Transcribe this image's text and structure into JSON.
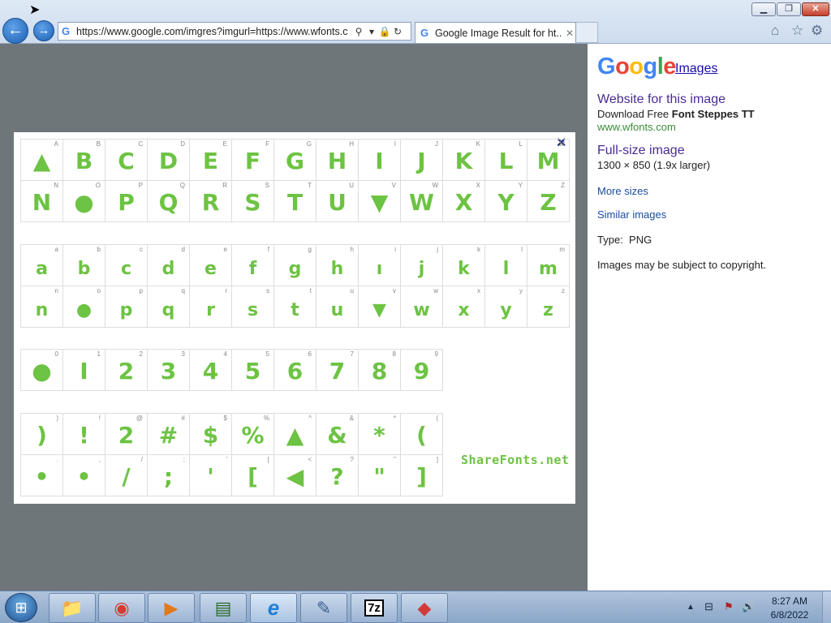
{
  "window": {
    "min_glyph": "▁",
    "max_glyph": "❐",
    "close_glyph": "✕"
  },
  "nav": {
    "back_glyph": "←",
    "forward_glyph": "→"
  },
  "address": {
    "favicon": "G",
    "url": "https://www.google.com/imgres?imgurl=https://www.wfonts.c",
    "search_glyph": "⚲",
    "dropdown_glyph": "▾",
    "lock_glyph": "🔒",
    "refresh_glyph": "↻"
  },
  "tab": {
    "favicon": "G",
    "title": "Google Image Result for ht...",
    "close_glyph": "✕"
  },
  "toolbar": {
    "home_glyph": "⌂",
    "star_glyph": "☆",
    "gear_glyph": "⚙"
  },
  "viewer": {
    "close_glyph": "✕",
    "upper": {
      "labels": [
        "A",
        "B",
        "C",
        "D",
        "E",
        "F",
        "G",
        "H",
        "I",
        "J",
        "K",
        "L",
        "M",
        "N",
        "O",
        "P",
        "Q",
        "R",
        "S",
        "T",
        "U",
        "V",
        "W",
        "X",
        "Y",
        "Z"
      ],
      "glyphs": [
        "▲",
        "B",
        "C",
        "D",
        "E",
        "F",
        "G",
        "H",
        "I",
        "J",
        "K",
        "L",
        "M",
        "N",
        "●",
        "P",
        "Q",
        "R",
        "S",
        "T",
        "U",
        "▼",
        "W",
        "X",
        "Y",
        "Z"
      ]
    },
    "lower": {
      "labels": [
        "a",
        "b",
        "c",
        "d",
        "e",
        "f",
        "g",
        "h",
        "i",
        "j",
        "k",
        "l",
        "m",
        "n",
        "o",
        "p",
        "q",
        "r",
        "s",
        "t",
        "u",
        "v",
        "w",
        "x",
        "y",
        "z"
      ],
      "glyphs": [
        "a",
        "b",
        "c",
        "d",
        "e",
        "f",
        "g",
        "h",
        "ı",
        "j",
        "k",
        "l",
        "m",
        "n",
        "●",
        "p",
        "q",
        "r",
        "s",
        "t",
        "u",
        "▼",
        "w",
        "x",
        "y",
        "z"
      ]
    },
    "digits": {
      "labels": [
        "0",
        "1",
        "2",
        "3",
        "4",
        "5",
        "6",
        "7",
        "8",
        "9"
      ],
      "glyphs": [
        "●",
        "I",
        "2",
        "3",
        "4",
        "5",
        "6",
        "7",
        "8",
        "9"
      ]
    },
    "symbols": {
      "labels": [
        ")",
        "!",
        "@",
        "#",
        "$",
        "%",
        "^",
        "&",
        "*",
        "(",
        ".",
        ",",
        "/",
        ";",
        "'",
        "[",
        "<",
        "?",
        "\"",
        "]"
      ],
      "glyphs": [
        ")",
        "!",
        "2",
        "#",
        "$",
        "%",
        "▲",
        "&",
        "*",
        "(",
        "•",
        "•",
        "/",
        ";",
        "'",
        "[",
        "◀",
        "?",
        "\"",
        "]"
      ]
    },
    "watermark": "ShareFonts.net"
  },
  "side": {
    "logo": [
      "G",
      "o",
      "o",
      "g",
      "l",
      "e"
    ],
    "logo_colors": [
      "#4285f4",
      "#ea4335",
      "#fbbc05",
      "#4285f4",
      "#34a853",
      "#ea4335"
    ],
    "images_link": "Images",
    "website_link": "Website for this image",
    "download_prefix": "Download Free ",
    "download_bold": "Font Steppes TT",
    "site": "www.wfonts.com",
    "fullsize_link": "Full-size image",
    "dimensions": "1300 × 850 (1.9x larger)",
    "more_sizes": "More sizes",
    "similar": "Similar images",
    "type_label": "Type:",
    "type_value": "PNG",
    "copyright": "Images may be subject to copyright."
  },
  "taskbar": {
    "start_glyph": "⊞",
    "apps": [
      {
        "name": "explorer",
        "glyph": "📁"
      },
      {
        "name": "chrome",
        "glyph": "◉"
      },
      {
        "name": "media",
        "glyph": "▶"
      },
      {
        "name": "monitor",
        "glyph": "▤"
      },
      {
        "name": "ie",
        "glyph": "e"
      },
      {
        "name": "notepad",
        "glyph": "✎"
      },
      {
        "name": "7zip",
        "glyph": "7z"
      },
      {
        "name": "cubes",
        "glyph": "◆"
      }
    ],
    "tray": {
      "up_glyph": "▲",
      "net_glyph": "⊟",
      "flag_glyph": "⚑",
      "vol_glyph": "🔊"
    },
    "time": "8:27 AM",
    "date": "6/8/2022"
  }
}
